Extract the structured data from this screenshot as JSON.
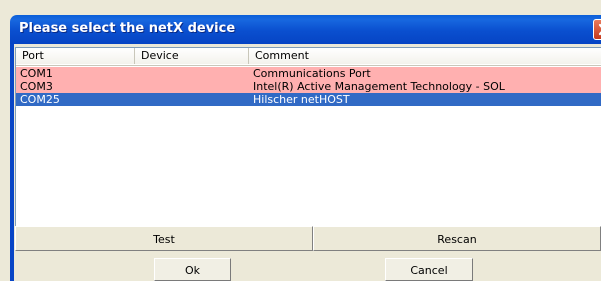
{
  "window": {
    "title": "Please select the netX device",
    "close_icon": "close-icon",
    "colors": {
      "titlebar": "#0a4fcf",
      "row_highlight": "#ffb0b0",
      "row_selected": "#316ac5",
      "close_button": "#d9542f"
    }
  },
  "table": {
    "columns": [
      "Port",
      "Device",
      "Comment"
    ],
    "rows": [
      {
        "port": "COM1",
        "device": "",
        "comment": "Communications Port",
        "state": "highlighted"
      },
      {
        "port": "COM3",
        "device": "",
        "comment": "Intel(R) Active Management Technology - SOL",
        "state": "highlighted"
      },
      {
        "port": "COM25",
        "device": "",
        "comment": "Hilscher netHOST",
        "state": "selected"
      }
    ]
  },
  "buttons": {
    "test": "Test",
    "rescan": "Rescan",
    "ok": "Ok",
    "cancel": "Cancel"
  }
}
